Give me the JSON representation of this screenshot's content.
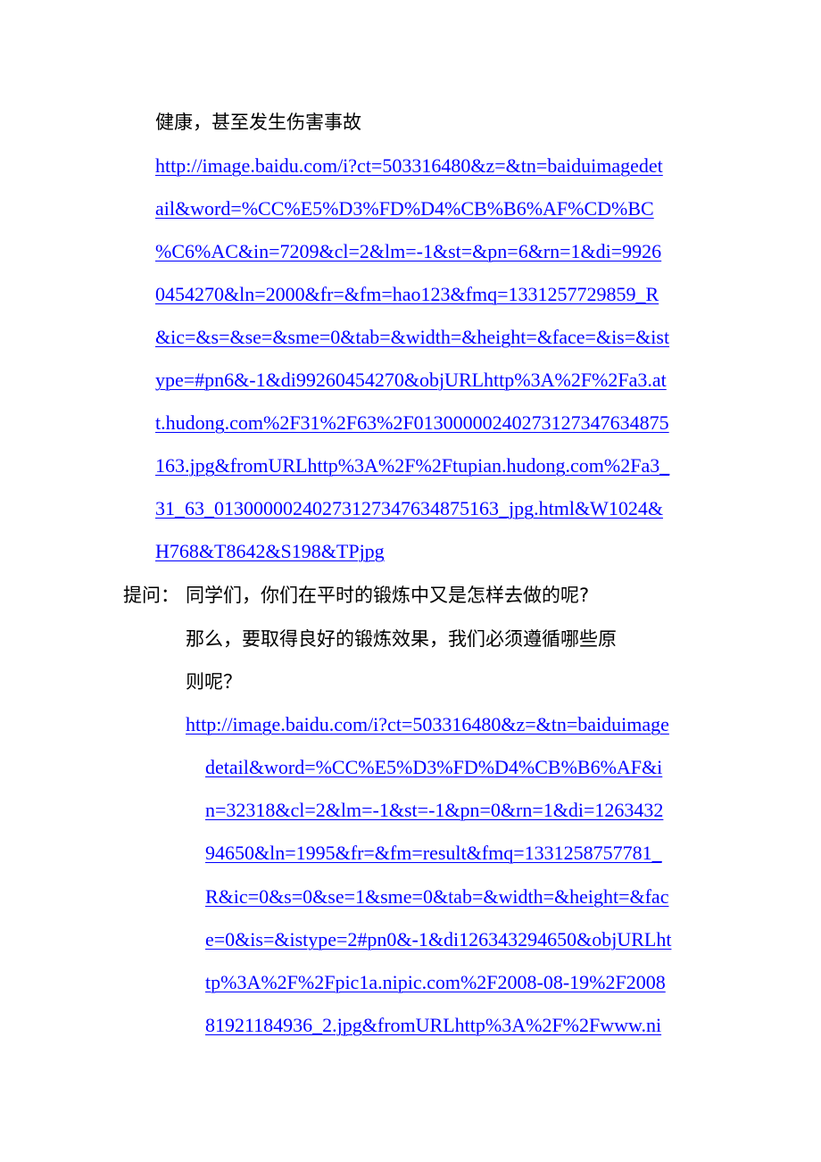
{
  "document": {
    "para1_tail": "健康，甚至发生伤害事故",
    "link1_lines": [
      "http://image.baidu.com/i?ct=503316480&z=&tn=baiduimagedet",
      "ail&word=%CC%E5%D3%FD%D4%CB%B6%AF%CD%BC",
      "%C6%AC&in=7209&cl=2&lm=-1&st=&pn=6&rn=1&di=9926",
      "0454270&ln=2000&fr=&fm=hao123&fmq=1331257729859_R",
      "&ic=&s=&se=&sme=0&tab=&width=&height=&face=&is=&ist",
      "ype=#pn6&-1&di99260454270&objURLhttp%3A%2F%2Fa3.at",
      "t.hudong.com%2F31%2F63%2F01300000240273127347634875",
      "163.jpg&fromURLhttp%3A%2F%2Ftupian.hudong.com%2Fa3_",
      "31_63_01300000240273127347634875163_jpg.html&W1024&",
      "H768&T8642&S198&TPjpg"
    ],
    "question_label": "提问：",
    "question_text": "同学们，你们在平时的锻炼中又是怎样去做的呢?",
    "followup_line1": "那么，要取得良好的锻炼效果，我们必须遵循哪些原",
    "followup_line2": "则呢？",
    "link2_lines": [
      "http://image.baidu.com/i?ct=503316480&z=&tn=baiduimage",
      "detail&word=%CC%E5%D3%FD%D4%CB%B6%AF&i",
      "n=32318&cl=2&lm=-1&st=-1&pn=0&rn=1&di=1263432",
      "94650&ln=1995&fr=&fm=result&fmq=1331258757781_",
      "R&ic=0&s=0&se=1&sme=0&tab=&width=&height=&fac",
      "e=0&is=&istype=2#pn0&-1&di126343294650&objURLht",
      "tp%3A%2F%2Fpic1a.nipic.com%2F2008-08-19%2F2008",
      "81921184936_2.jpg&fromURLhttp%3A%2F%2Fwww.ni"
    ]
  },
  "colors": {
    "link": "#0000ff",
    "text": "#000000"
  }
}
